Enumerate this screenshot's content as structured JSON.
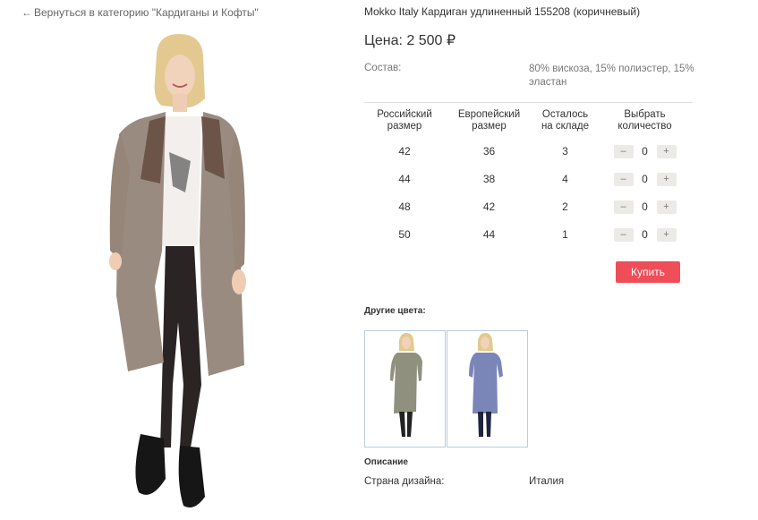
{
  "nav": {
    "back_arrow": "←",
    "back_label": "Вернуться в категорию \"Кардиганы и Кофты\""
  },
  "product": {
    "title": "Mokko Italy Кардиган удлиненный 155208 (коричневый)",
    "price": "Цена: 2 500 ₽",
    "composition_label": "Состав:",
    "composition_value": "80% вискоза, 15% полиэстер, 15% эластан",
    "main_image_icon": "model-photo-brown-cardigan"
  },
  "sizes_table": {
    "headers": [
      {
        "line1": "Российский",
        "line2": "размер"
      },
      {
        "line1": "Европейский",
        "line2": "размер"
      },
      {
        "line1": "Осталось",
        "line2": "на складе"
      },
      {
        "line1": "Выбрать",
        "line2": "количество"
      }
    ],
    "rows": [
      {
        "ru": "42",
        "eu": "36",
        "stock": "3",
        "qty": "0"
      },
      {
        "ru": "44",
        "eu": "38",
        "stock": "4",
        "qty": "0"
      },
      {
        "ru": "48",
        "eu": "42",
        "stock": "2",
        "qty": "0"
      },
      {
        "ru": "50",
        "eu": "44",
        "stock": "1",
        "qty": "0"
      }
    ],
    "minus": "–",
    "plus": "+"
  },
  "buy_label": "Купить",
  "other_colors": {
    "heading": "Другие цвета:",
    "items": [
      {
        "icon": "model-photo-olive-cardigan",
        "color": "#8f917e"
      },
      {
        "icon": "model-photo-blue-cardigan",
        "color": "#7a86b8"
      }
    ]
  },
  "description": {
    "heading": "Описание",
    "country_label": "Страна дизайна:",
    "country_value": "Италия"
  },
  "colors": {
    "accent": "#ef4d58",
    "cardigan_brown": "#9a8b80"
  }
}
